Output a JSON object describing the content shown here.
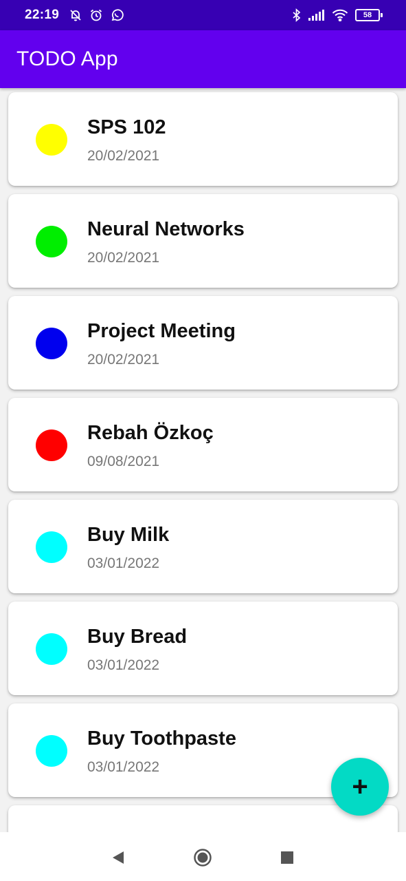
{
  "status_bar": {
    "time": "22:19",
    "battery_level": "58",
    "left_icons": [
      "bell-off-icon",
      "alarm-icon",
      "whatsapp-icon"
    ],
    "right_icons": [
      "bluetooth-icon",
      "signal-icon",
      "wifi-icon",
      "battery-icon"
    ]
  },
  "app_bar": {
    "title": "TODO App"
  },
  "todos": [
    {
      "title": "SPS 102",
      "date": "20/02/2021",
      "color": "#ffff00"
    },
    {
      "title": "Neural Networks",
      "date": "20/02/2021",
      "color": "#00ee00"
    },
    {
      "title": "Project Meeting",
      "date": "20/02/2021",
      "color": "#0000ee"
    },
    {
      "title": "Rebah Özkoç",
      "date": "09/08/2021",
      "color": "#ff0000"
    },
    {
      "title": "Buy Milk",
      "date": "03/01/2022",
      "color": "#00ffff"
    },
    {
      "title": "Buy Bread",
      "date": "03/01/2022",
      "color": "#00ffff"
    },
    {
      "title": "Buy Toothpaste",
      "date": "03/01/2022",
      "color": "#00ffff"
    }
  ],
  "fab": {
    "label": "+",
    "color": "#03dac5"
  },
  "nav_bar": {
    "buttons": [
      "back-icon",
      "home-icon",
      "recents-icon"
    ]
  },
  "colors": {
    "primary": "#6200ee",
    "primary_dark": "#3700b3",
    "accent": "#03dac5"
  }
}
